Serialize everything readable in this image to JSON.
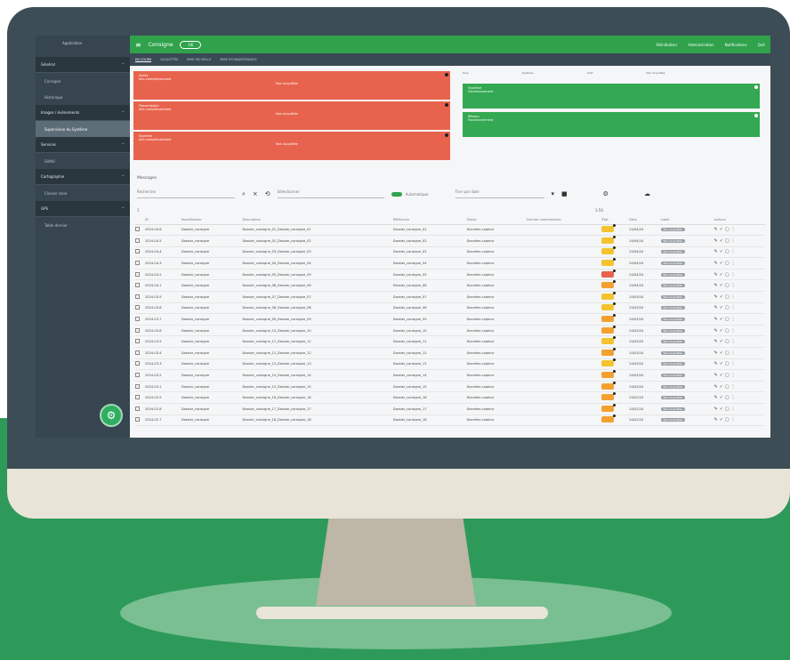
{
  "app": {
    "logo_text": "Application",
    "title": "Consigne",
    "pill": "OK",
    "top_links": [
      "Réinitialiser",
      "Administration",
      "Notifications",
      "Quit"
    ]
  },
  "sidebar": {
    "sections": [
      {
        "label": "Général",
        "items": [
          "Consigne",
          "Historique"
        ]
      },
      {
        "label": "Images / événements",
        "items": [
          "Supervision du Système"
        ]
      },
      {
        "label": "Services",
        "items": [
          "SAMU"
        ]
      },
      {
        "label": "Cartographie",
        "items": [
          "Classer zone"
        ]
      },
      {
        "label": "GPS",
        "items": [
          "Table dernier"
        ]
      }
    ],
    "active_item": "Supervision du Système"
  },
  "tabs": [
    "EN COURS",
    "ACQUITTÉS",
    "MISE EN VEILLE",
    "MISE EN MAINTENANCE"
  ],
  "alerts": [
    {
      "title": "Alerte",
      "subtitle": "Info complémentaire",
      "center": "Non Acquittée"
    },
    {
      "title": "Transmission",
      "subtitle": "Info complémentaire",
      "center": "Non Acquittée"
    },
    {
      "title": "Système",
      "subtitle": "Info complémentaire",
      "center": "Non Acquittée"
    }
  ],
  "ok_cards": [
    {
      "title": "Système",
      "subtitle": "Fonctionnement"
    },
    {
      "title": "Réseau",
      "subtitle": "Fonctionnement"
    }
  ],
  "filters": [
    "Tous",
    "Système",
    "Actif",
    "Non Acquittée"
  ],
  "section_title": "Messages",
  "toolbar": {
    "search_placeholder": "Recherche",
    "select_placeholder": "Sélectionner",
    "toggle_label": "Automatique",
    "sort_label": "Trier par date"
  },
  "pager": {
    "page": "1",
    "range": "1-50"
  },
  "table": {
    "headers": [
      "",
      "ID",
      "Nom/Dossier",
      "Description",
      "Référence",
      "Statut",
      "Dernier commentaire",
      "État",
      "Date",
      "Label",
      "Actions"
    ],
    "rows": [
      {
        "id": "2024-04-6",
        "name": "Dossier_consigne",
        "desc": "Dossier_consigne_01_Dossier_consigne_01",
        "ref": "Dossier_consigne_01",
        "status": "Données capteur",
        "state": "#f4c430",
        "date": "24/04/24",
        "label": "Non Acquittée"
      },
      {
        "id": "2024-04-5",
        "name": "Dossier_consigne",
        "desc": "Dossier_consigne_02_Dossier_consigne_02",
        "ref": "Dossier_consigne_02",
        "status": "Données capteur",
        "state": "#f4c430",
        "date": "24/04/24",
        "label": "Non Acquittée"
      },
      {
        "id": "2024-04-4",
        "name": "Dossier_consigne",
        "desc": "Dossier_consigne_03_Dossier_consigne_03",
        "ref": "Dossier_consigne_03",
        "status": "Données capteur",
        "state": "#f4c430",
        "date": "24/04/24",
        "label": "Non Acquittée"
      },
      {
        "id": "2024-04-3",
        "name": "Dossier_consigne",
        "desc": "Dossier_consigne_04_Dossier_consigne_04",
        "ref": "Dossier_consigne_04",
        "status": "Données capteur",
        "state": "#f4c430",
        "date": "24/04/24",
        "label": "Non Acquittée"
      },
      {
        "id": "2024-04-2",
        "name": "Dossier_consigne",
        "desc": "Dossier_consigne_05_Dossier_consigne_05",
        "ref": "Dossier_consigne_05",
        "status": "Données capteur",
        "state": "#e8634d",
        "date": "24/04/24",
        "label": "Non Acquittée"
      },
      {
        "id": "2024-04-1",
        "name": "Dossier_consigne",
        "desc": "Dossier_consigne_06_Dossier_consigne_06",
        "ref": "Dossier_consigne_06",
        "status": "Données capteur",
        "state": "#f4a030",
        "date": "24/04/24",
        "label": "Non Acquittée"
      },
      {
        "id": "2024-03-9",
        "name": "Dossier_consigne",
        "desc": "Dossier_consigne_07_Dossier_consigne_07",
        "ref": "Dossier_consigne_07",
        "status": "Données capteur",
        "state": "#f4c430",
        "date": "24/03/24",
        "label": "Non Acquittée"
      },
      {
        "id": "2024-03-8",
        "name": "Dossier_consigne",
        "desc": "Dossier_consigne_08_Dossier_consigne_08",
        "ref": "Dossier_consigne_08",
        "status": "Données capteur",
        "state": "#f4c430",
        "date": "24/03/24",
        "label": "Non Acquittée"
      },
      {
        "id": "2024-03-7",
        "name": "Dossier_consigne",
        "desc": "Dossier_consigne_09_Dossier_consigne_09",
        "ref": "Dossier_consigne_09",
        "status": "Données capteur",
        "state": "#f4a030",
        "date": "24/03/24",
        "label": "Non Acquittée"
      },
      {
        "id": "2024-03-6",
        "name": "Dossier_consigne",
        "desc": "Dossier_consigne_10_Dossier_consigne_10",
        "ref": "Dossier_consigne_10",
        "status": "Données capteur",
        "state": "#f4a030",
        "date": "24/03/24",
        "label": "Non Acquittée"
      },
      {
        "id": "2024-03-5",
        "name": "Dossier_consigne",
        "desc": "Dossier_consigne_11_Dossier_consigne_11",
        "ref": "Dossier_consigne_11",
        "status": "Données capteur",
        "state": "#f4c430",
        "date": "24/03/24",
        "label": "Non Acquittée"
      },
      {
        "id": "2024-03-4",
        "name": "Dossier_consigne",
        "desc": "Dossier_consigne_12_Dossier_consigne_12",
        "ref": "Dossier_consigne_12",
        "status": "Données capteur",
        "state": "#f4a030",
        "date": "24/03/24",
        "label": "Non Acquittée"
      },
      {
        "id": "2024-03-3",
        "name": "Dossier_consigne",
        "desc": "Dossier_consigne_13_Dossier_consigne_13",
        "ref": "Dossier_consigne_13",
        "status": "Données capteur",
        "state": "#f4c430",
        "date": "24/03/24",
        "label": "Non Acquittée"
      },
      {
        "id": "2024-03-2",
        "name": "Dossier_consigne",
        "desc": "Dossier_consigne_14_Dossier_consigne_14",
        "ref": "Dossier_consigne_14",
        "status": "Données capteur",
        "state": "#f4a030",
        "date": "24/03/24",
        "label": "Non Acquittée"
      },
      {
        "id": "2024-03-1",
        "name": "Dossier_consigne",
        "desc": "Dossier_consigne_15_Dossier_consigne_15",
        "ref": "Dossier_consigne_15",
        "status": "Données capteur",
        "state": "#f4a030",
        "date": "24/03/24",
        "label": "Non Acquittée"
      },
      {
        "id": "2024-02-9",
        "name": "Dossier_consigne",
        "desc": "Dossier_consigne_16_Dossier_consigne_16",
        "ref": "Dossier_consigne_16",
        "status": "Données capteur",
        "state": "#f4a030",
        "date": "24/02/24",
        "label": "Non Acquittée"
      },
      {
        "id": "2024-02-8",
        "name": "Dossier_consigne",
        "desc": "Dossier_consigne_17_Dossier_consigne_17",
        "ref": "Dossier_consigne_17",
        "status": "Données capteur",
        "state": "#f4a030",
        "date": "24/02/24",
        "label": "Non Acquittée"
      },
      {
        "id": "2024-02-7",
        "name": "Dossier_consigne",
        "desc": "Dossier_consigne_18_Dossier_consigne_18",
        "ref": "Dossier_consigne_18",
        "status": "Données capteur",
        "state": "#f4a030",
        "date": "24/02/24",
        "label": "Non Acquittée"
      }
    ]
  },
  "icons": {
    "search": "search-icon",
    "close": "close-icon",
    "settings": "gear-icon",
    "sort": "sort-icon",
    "cloud": "cloud-icon"
  },
  "colors": {
    "accent": "#2fa24b",
    "alert": "#e8634d",
    "sidebar": "#364550",
    "page_green": "#2e9a5a"
  }
}
